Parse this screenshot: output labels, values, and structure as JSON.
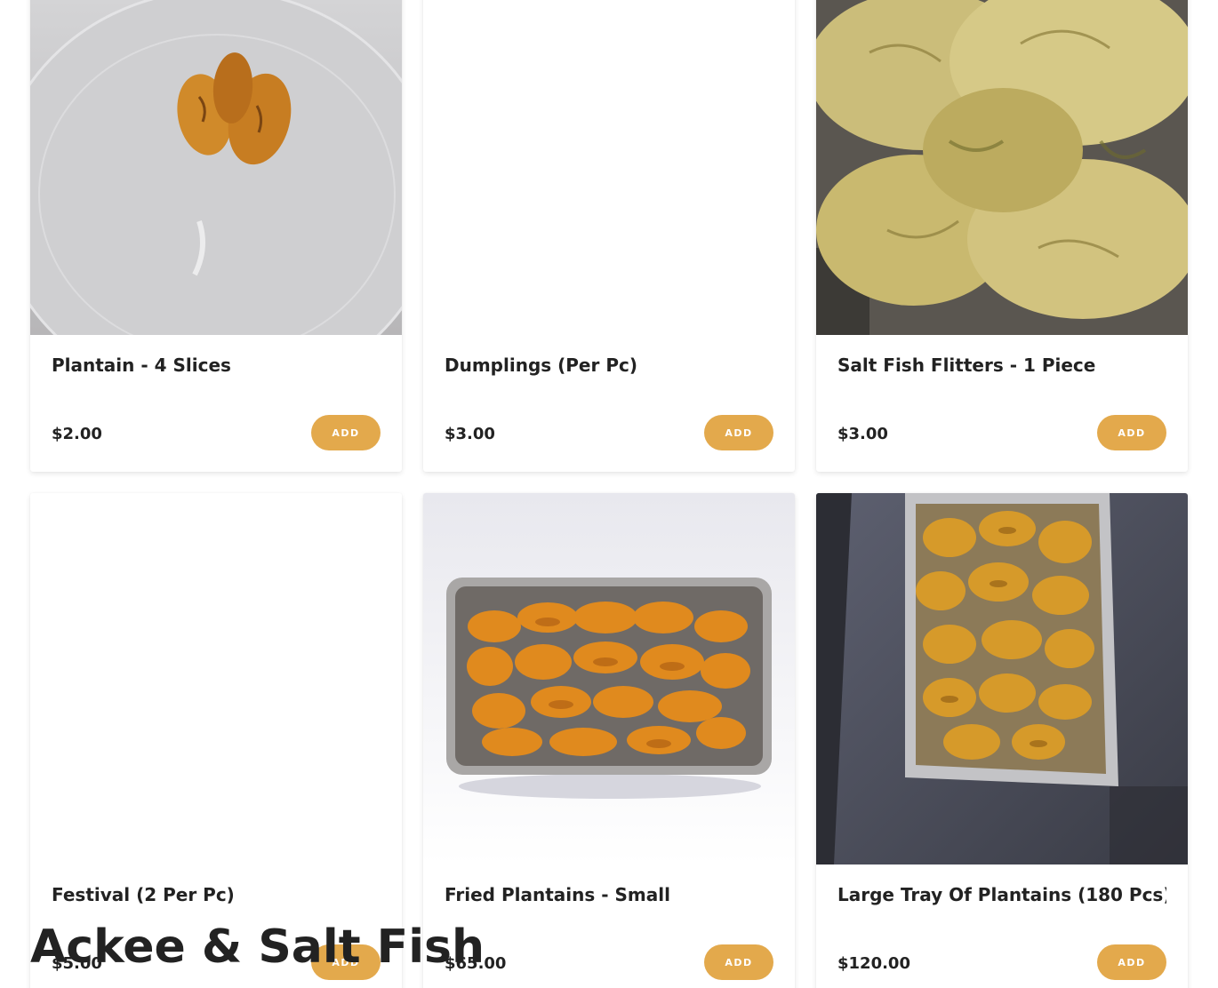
{
  "menu": {
    "items": [
      {
        "name": "Plantain - 4 Slices",
        "price": "$2.00",
        "add_label": "ADD",
        "image": "plantain-slices-on-plate"
      },
      {
        "name": "Dumplings (Per Pc)",
        "price": "$3.00",
        "add_label": "ADD",
        "image": "blank"
      },
      {
        "name": "Salt Fish Flitters - 1 Piece",
        "price": "$3.00",
        "add_label": "ADD",
        "image": "fried-fritters"
      },
      {
        "name": "Festival (2 Per Pc)",
        "price": "$5.00",
        "add_label": "ADD",
        "image": "blank"
      },
      {
        "name": "Fried Plantains - Small",
        "price": "$65.00",
        "add_label": "ADD",
        "image": "plantains-in-tray"
      },
      {
        "name": "Large Tray Of Plantains (180 Pcs)",
        "price": "$120.00",
        "add_label": "ADD",
        "image": "plantains-in-large-tray"
      }
    ]
  },
  "next_section": {
    "heading": "Ackee & Salt Fish"
  },
  "colors": {
    "accent": "#e3a94c",
    "text": "#222222",
    "background": "#ffffff"
  }
}
